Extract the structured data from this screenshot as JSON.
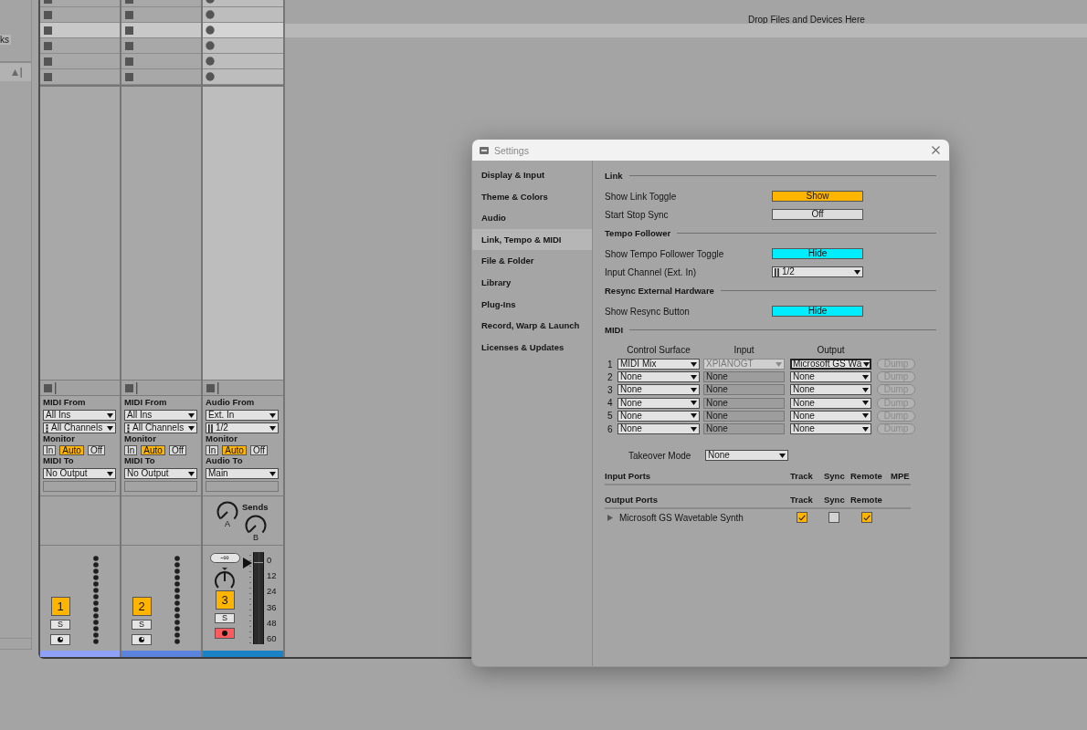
{
  "browser": {
    "label": "ks"
  },
  "scenes": [
    {
      "selected": false
    },
    {
      "selected": false
    },
    {
      "selected": true
    },
    {
      "selected": false
    },
    {
      "selected": false
    },
    {
      "selected": false
    }
  ],
  "drop_area": {
    "text": "Drop Files and Devices Here"
  },
  "tracks": [
    {
      "kind": "midi",
      "armed": false,
      "color": "#8fa1f5",
      "io": {
        "from_label": "MIDI From",
        "from": "All Ins",
        "channel": "All Channels",
        "monitor_label": "Monitor",
        "monitor": [
          {
            "label": "In",
            "selected": false
          },
          {
            "label": "Auto",
            "selected": true
          },
          {
            "label": "Off",
            "selected": false
          }
        ],
        "to_label": "MIDI To",
        "to": "No Output"
      },
      "mixer": {
        "number": "1",
        "active": true,
        "solo": {
          "label": "S",
          "on": false
        }
      }
    },
    {
      "kind": "midi",
      "armed": false,
      "color": "#5b84df",
      "io": {
        "from_label": "MIDI From",
        "from": "All Ins",
        "channel": "All Channels",
        "monitor_label": "Monitor",
        "monitor": [
          {
            "label": "In",
            "selected": false
          },
          {
            "label": "Auto",
            "selected": true
          },
          {
            "label": "Off",
            "selected": false
          }
        ],
        "to_label": "MIDI To",
        "to": "No Output"
      },
      "mixer": {
        "number": "2",
        "active": true,
        "solo": {
          "label": "S",
          "on": false
        }
      }
    },
    {
      "kind": "audio",
      "armed": true,
      "color": "#1a83c6",
      "io": {
        "from_label": "Audio From",
        "from": "Ext. In",
        "channel": "1/2",
        "monitor_label": "Monitor",
        "monitor": [
          {
            "label": "In",
            "selected": false
          },
          {
            "label": "Auto",
            "selected": true
          },
          {
            "label": "Off",
            "selected": false
          }
        ],
        "to_label": "Audio To",
        "to": "Main"
      },
      "sends": {
        "label": "Sends",
        "knobs": [
          {
            "label": "A"
          },
          {
            "label": "B"
          }
        ]
      },
      "mixer": {
        "number": "3",
        "active": true,
        "solo": {
          "label": "S",
          "on": false
        },
        "peak": "-∞",
        "volume": {
          "level": 0.88
        },
        "scale": [
          "0",
          "12",
          "24",
          "36",
          "48",
          "60"
        ]
      }
    }
  ],
  "settings": {
    "title": "Settings",
    "nav": [
      {
        "label": "Display & Input",
        "selected": false
      },
      {
        "label": "Theme & Colors",
        "selected": false
      },
      {
        "label": "Audio",
        "selected": false
      },
      {
        "label": "Link, Tempo & MIDI",
        "selected": true
      },
      {
        "label": "File & Folder",
        "selected": false
      },
      {
        "label": "Library",
        "selected": false
      },
      {
        "label": "Plug-Ins",
        "selected": false
      },
      {
        "label": "Record, Warp & Launch",
        "selected": false
      },
      {
        "label": "Licenses & Updates",
        "selected": false
      }
    ],
    "sections": [
      {
        "title": "Link",
        "rows": [
          {
            "kind": "toggle",
            "label": "Show Link Toggle",
            "value": "Show",
            "color": "#ffb400"
          },
          {
            "kind": "toggle",
            "label": "Start Stop Sync",
            "value": "Off",
            "color": "#dcdcdc"
          }
        ]
      },
      {
        "title": "Tempo Follower",
        "rows": [
          {
            "kind": "toggle",
            "label": "Show Tempo Follower Toggle",
            "value": "Hide",
            "color": "#00ecff"
          },
          {
            "kind": "dropdown",
            "label": "Input Channel (Ext. In)",
            "value": "1/2"
          }
        ]
      },
      {
        "title": "Resync External Hardware",
        "rows": [
          {
            "kind": "toggle",
            "label": "Show Resync Button",
            "value": "Hide",
            "color": "#00ecff"
          }
        ]
      },
      {
        "title": "MIDI"
      }
    ],
    "midi": {
      "columns": [
        "Control Surface",
        "Input",
        "Output"
      ],
      "rows": [
        {
          "number": "1",
          "control_surface": "MIDI Mix",
          "input": {
            "value": "XPIANOGT",
            "disabled": false
          },
          "output": {
            "value": "Microsoft GS Wa",
            "focused": true
          },
          "dump": {
            "label": "Dump",
            "disabled": true
          }
        },
        {
          "number": "2",
          "control_surface": "None",
          "input": {
            "value": "None",
            "disabled": true
          },
          "output": {
            "value": "None",
            "focused": false
          },
          "dump": {
            "label": "Dump",
            "disabled": true
          }
        },
        {
          "number": "3",
          "control_surface": "None",
          "input": {
            "value": "None",
            "disabled": true
          },
          "output": {
            "value": "None",
            "focused": false
          },
          "dump": {
            "label": "Dump",
            "disabled": true
          }
        },
        {
          "number": "4",
          "control_surface": "None",
          "input": {
            "value": "None",
            "disabled": true
          },
          "output": {
            "value": "None",
            "focused": false
          },
          "dump": {
            "label": "Dump",
            "disabled": true
          }
        },
        {
          "number": "5",
          "control_surface": "None",
          "input": {
            "value": "None",
            "disabled": true
          },
          "output": {
            "value": "None",
            "focused": false
          },
          "dump": {
            "label": "Dump",
            "disabled": true
          }
        },
        {
          "number": "6",
          "control_surface": "None",
          "input": {
            "value": "None",
            "disabled": true
          },
          "output": {
            "value": "None",
            "focused": false
          },
          "dump": {
            "label": "Dump",
            "disabled": true
          }
        }
      ],
      "takeover": {
        "label": "Takeover Mode",
        "value": "None"
      }
    },
    "input_ports": {
      "title": "Input Ports",
      "columns": [
        "Track",
        "Sync",
        "Remote",
        "MPE"
      ]
    },
    "output_ports": {
      "title": "Output Ports",
      "columns": [
        "Track",
        "Sync",
        "Remote"
      ],
      "ports": [
        {
          "name": "Microsoft GS Wavetable Synth",
          "expanded": false,
          "track": true,
          "sync": false,
          "remote": true
        }
      ]
    }
  }
}
